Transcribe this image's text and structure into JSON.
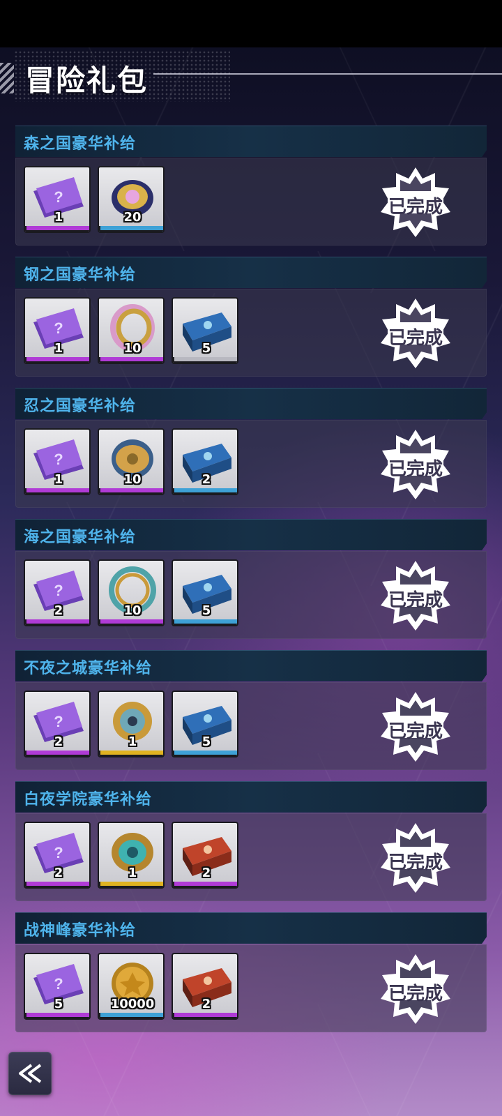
{
  "header": {
    "title": "冒险礼包"
  },
  "badge_label": "已完成",
  "packs": [
    {
      "title": "森之国豪华补给",
      "status": "已完成",
      "items": [
        {
          "icon": "mystery-ticket-icon",
          "qty": "1",
          "rarity": "purple"
        },
        {
          "icon": "beyblade-disc-icon",
          "qty": "20",
          "rarity": "blue"
        }
      ]
    },
    {
      "title": "钢之国豪华补给",
      "status": "已完成",
      "items": [
        {
          "icon": "mystery-ticket-icon",
          "qty": "1",
          "rarity": "purple"
        },
        {
          "icon": "gold-ring-blade-icon",
          "qty": "10",
          "rarity": "purple"
        },
        {
          "icon": "supply-crate-icon",
          "qty": "5",
          "rarity": "gray"
        }
      ]
    },
    {
      "title": "忍之国豪华补给",
      "status": "已完成",
      "items": [
        {
          "icon": "mystery-ticket-icon",
          "qty": "1",
          "rarity": "purple"
        },
        {
          "icon": "gold-dragon-blade-icon",
          "qty": "10",
          "rarity": "purple"
        },
        {
          "icon": "supply-crate-icon",
          "qty": "2",
          "rarity": "blue"
        }
      ]
    },
    {
      "title": "海之国豪华补给",
      "status": "已完成",
      "items": [
        {
          "icon": "mystery-ticket-icon",
          "qty": "2",
          "rarity": "purple"
        },
        {
          "icon": "teal-ring-blade-icon",
          "qty": "10",
          "rarity": "purple"
        },
        {
          "icon": "supply-crate-icon",
          "qty": "5",
          "rarity": "blue"
        }
      ]
    },
    {
      "title": "不夜之城豪华补给",
      "status": "已完成",
      "items": [
        {
          "icon": "mystery-ticket-icon",
          "qty": "2",
          "rarity": "purple"
        },
        {
          "icon": "gold-core-blade-icon",
          "qty": "1",
          "rarity": "gold"
        },
        {
          "icon": "supply-crate-icon",
          "qty": "5",
          "rarity": "blue"
        }
      ]
    },
    {
      "title": "白夜学院豪华补给",
      "status": "已完成",
      "items": [
        {
          "icon": "mystery-ticket-icon",
          "qty": "2",
          "rarity": "purple"
        },
        {
          "icon": "teal-gear-blade-icon",
          "qty": "1",
          "rarity": "gold"
        },
        {
          "icon": "red-supply-crate-icon",
          "qty": "2",
          "rarity": "purple"
        }
      ]
    },
    {
      "title": "战神峰豪华补给",
      "status": "已完成",
      "items": [
        {
          "icon": "mystery-ticket-icon",
          "qty": "5",
          "rarity": "purple"
        },
        {
          "icon": "gold-coin-icon",
          "qty": "10000",
          "rarity": "blue"
        },
        {
          "icon": "red-supply-crate-icon",
          "qty": "2",
          "rarity": "purple"
        }
      ]
    }
  ],
  "footer": {
    "back_icon": "double-chevron-left-icon"
  }
}
